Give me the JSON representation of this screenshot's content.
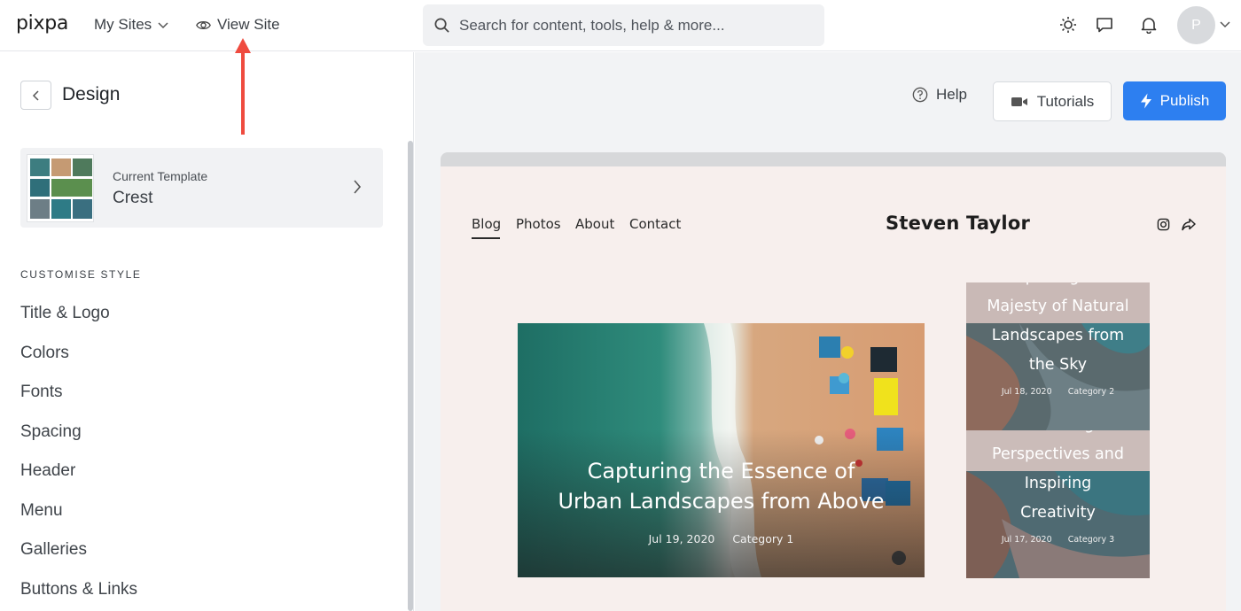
{
  "topbar": {
    "logo": "pixpa",
    "my_sites": "My Sites",
    "view_site": "View Site",
    "search_placeholder": "Search for content, tools, help & more...",
    "avatar_initial": "P"
  },
  "sidebar": {
    "title": "Design",
    "template_label": "Current Template",
    "template_name": "Crest",
    "section_heading": "CUSTOMISE STYLE",
    "items": [
      "Title & Logo",
      "Colors",
      "Fonts",
      "Spacing",
      "Header",
      "Menu",
      "Galleries",
      "Buttons & Links"
    ]
  },
  "actions": {
    "help": "Help",
    "tutorials": "Tutorials",
    "publish": "Publish"
  },
  "preview": {
    "nav": [
      "Blog",
      "Photos",
      "About",
      "Contact"
    ],
    "site_title": "Steven Taylor",
    "featured": {
      "title_line1": "Capturing the Essence of",
      "title_line2": "Urban Landscapes from Above",
      "date": "Jul 19, 2020",
      "category": "Category 1"
    },
    "cards": [
      {
        "title_lines": [
          "Exploring the",
          "Majesty of Natural",
          "Landscapes from",
          "the Sky"
        ],
        "date": "Jul 18, 2020",
        "category": "Category 2"
      },
      {
        "title_lines": [
          "Elevating",
          "Perspectives and",
          "Inspiring",
          "Creativity"
        ],
        "date": "Jul 17, 2020",
        "category": "Category 3"
      }
    ]
  },
  "colors": {
    "publish": "#2d7ff0",
    "annotation_arrow": "#ef4b3f",
    "preview_bg": "#f7efed"
  }
}
